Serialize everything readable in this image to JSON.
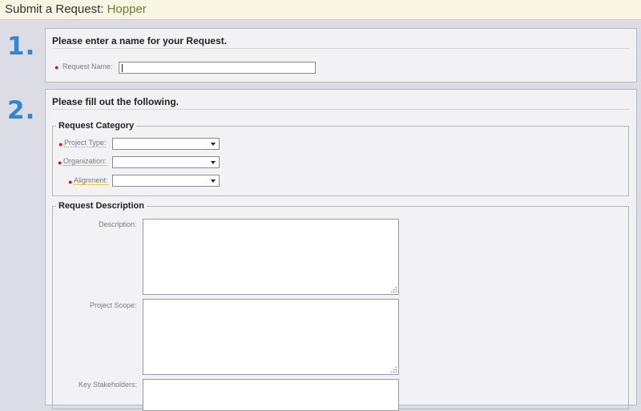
{
  "window": {
    "title_prefix": "Submit a Request: ",
    "app_name": "Hopper"
  },
  "steps": [
    {
      "number": "1.",
      "heading": "Please enter a name for your Request."
    },
    {
      "number": "2.",
      "heading": "Please fill out the following."
    }
  ],
  "request_name": {
    "label": "Request Name:",
    "value": "",
    "required": true
  },
  "category": {
    "legend": "Request Category",
    "fields": [
      {
        "label": "Project Type:",
        "selected": "",
        "required": true
      },
      {
        "label": "Organization:",
        "selected": "",
        "required": true
      },
      {
        "label": "Alignment:",
        "selected": "",
        "required": true
      }
    ]
  },
  "description": {
    "legend": "Request Description",
    "fields": [
      {
        "label": "Description:",
        "value": ""
      },
      {
        "label": "Project Scope:",
        "value": ""
      },
      {
        "label": "Key Stakeholders:",
        "value": ""
      }
    ]
  },
  "required_marker": "●",
  "colors": {
    "step_number": "#2f86d6",
    "required": "#dd1111",
    "app_name": "#6f7a3a"
  }
}
